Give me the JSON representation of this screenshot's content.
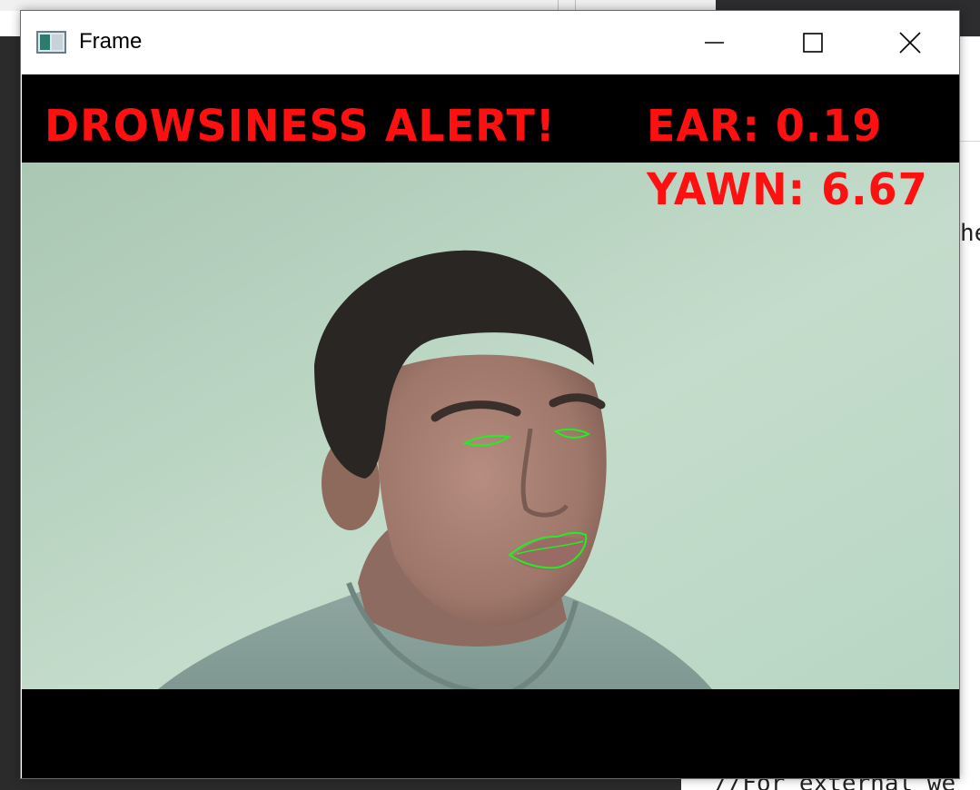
{
  "window": {
    "title": "Frame",
    "icon": "opencv-window-icon",
    "controls": {
      "minimize": "minimize-icon",
      "maximize": "maximize-icon",
      "close": "close-icon"
    }
  },
  "overlay": {
    "alert": "DROWSINESS ALERT!",
    "ear_label": "EAR:",
    "ear_value": "0.19",
    "yawn_label": "YAWN:",
    "yawn_value": "6.67",
    "text_color": "#ff1010",
    "landmark_color": "#22ee22"
  },
  "background": {
    "right_code_fragment": "he",
    "bottom_code_fragment": "//For external we"
  }
}
